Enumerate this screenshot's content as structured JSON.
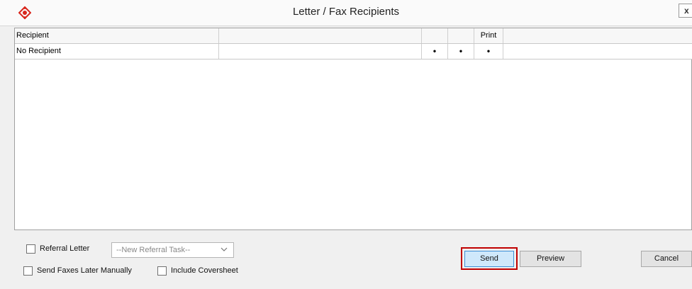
{
  "window": {
    "title": "Letter / Fax Recipients",
    "close_label": "x",
    "accent_color": "#d9261c"
  },
  "grid": {
    "columns": [
      "Recipient",
      "",
      "",
      "",
      "Print",
      ""
    ],
    "rows": [
      {
        "recipient": "No Recipient",
        "col2": "",
        "col3": "•",
        "col4": "•",
        "print": "•",
        "col6": ""
      }
    ]
  },
  "options": {
    "referral_letter_label": "Referral Letter",
    "referral_letter_checked": false,
    "referral_task_value": "--New Referral Task--",
    "send_faxes_later_label": "Send Faxes Later Manually",
    "send_faxes_later_checked": false,
    "include_coversheet_label": "Include Coversheet",
    "include_coversheet_checked": false
  },
  "buttons": {
    "send": "Send",
    "preview": "Preview",
    "cancel": "Cancel"
  }
}
